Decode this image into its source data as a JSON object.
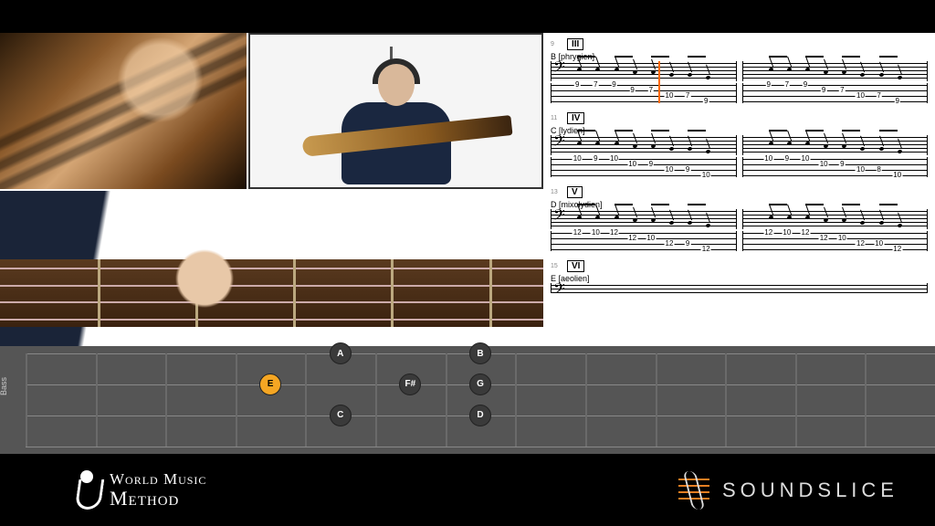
{
  "fretboard": {
    "label": "Bass",
    "strings": 4,
    "notes": [
      {
        "string": 1,
        "fret": 5,
        "label": "A",
        "root": false
      },
      {
        "string": 1,
        "fret": 7,
        "label": "B",
        "root": false
      },
      {
        "string": 2,
        "fret": 4,
        "label": "E",
        "root": true
      },
      {
        "string": 2,
        "fret": 6,
        "label": "F#",
        "root": false
      },
      {
        "string": 2,
        "fret": 7,
        "label": "G",
        "root": false
      },
      {
        "string": 3,
        "fret": 5,
        "label": "C",
        "root": false
      },
      {
        "string": 3,
        "fret": 7,
        "label": "D",
        "root": false
      }
    ]
  },
  "notation": {
    "playhead_system": 0,
    "playhead_pct": 58,
    "systems": [
      {
        "bar": 9,
        "roman": "III",
        "mode": "B [phrygien]",
        "measures": [
          {
            "tab": [
              [
                1,
                9
              ],
              [
                1,
                7
              ],
              [
                1,
                9
              ],
              [
                2,
                9
              ],
              [
                2,
                7
              ],
              [
                3,
                10
              ],
              [
                3,
                7
              ],
              [
                4,
                9
              ]
            ]
          },
          {
            "tab": [
              [
                1,
                9
              ],
              [
                1,
                7
              ],
              [
                1,
                9
              ],
              [
                2,
                9
              ],
              [
                2,
                7
              ],
              [
                3,
                10
              ],
              [
                3,
                7
              ],
              [
                4,
                9
              ]
            ]
          }
        ]
      },
      {
        "bar": 11,
        "roman": "IV",
        "mode": "C [lydien]",
        "measures": [
          {
            "tab": [
              [
                1,
                10
              ],
              [
                1,
                9
              ],
              [
                1,
                10
              ],
              [
                2,
                10
              ],
              [
                2,
                9
              ],
              [
                3,
                10
              ],
              [
                3,
                9
              ],
              [
                4,
                10
              ]
            ]
          },
          {
            "tab": [
              [
                1,
                10
              ],
              [
                1,
                9
              ],
              [
                1,
                10
              ],
              [
                2,
                10
              ],
              [
                2,
                9
              ],
              [
                3,
                10
              ],
              [
                3,
                8
              ],
              [
                4,
                10
              ]
            ]
          }
        ]
      },
      {
        "bar": 13,
        "roman": "V",
        "mode": "D [mixolydien]",
        "measures": [
          {
            "tab": [
              [
                1,
                12
              ],
              [
                1,
                10
              ],
              [
                1,
                12
              ],
              [
                2,
                12
              ],
              [
                2,
                10
              ],
              [
                3,
                12
              ],
              [
                3,
                9
              ],
              [
                4,
                12
              ]
            ]
          },
          {
            "tab": [
              [
                1,
                12
              ],
              [
                1,
                10
              ],
              [
                1,
                12
              ],
              [
                2,
                12
              ],
              [
                2,
                10
              ],
              [
                3,
                12
              ],
              [
                3,
                10
              ],
              [
                4,
                12
              ]
            ]
          }
        ]
      },
      {
        "bar": 15,
        "roman": "VI",
        "mode": "E [aeolien]",
        "measures": [
          {
            "tab": []
          }
        ],
        "partial": true
      }
    ]
  },
  "brands": {
    "wmm": {
      "line1": "World Music",
      "line2": "Method"
    },
    "soundslice": "SOUNDSLICE"
  }
}
